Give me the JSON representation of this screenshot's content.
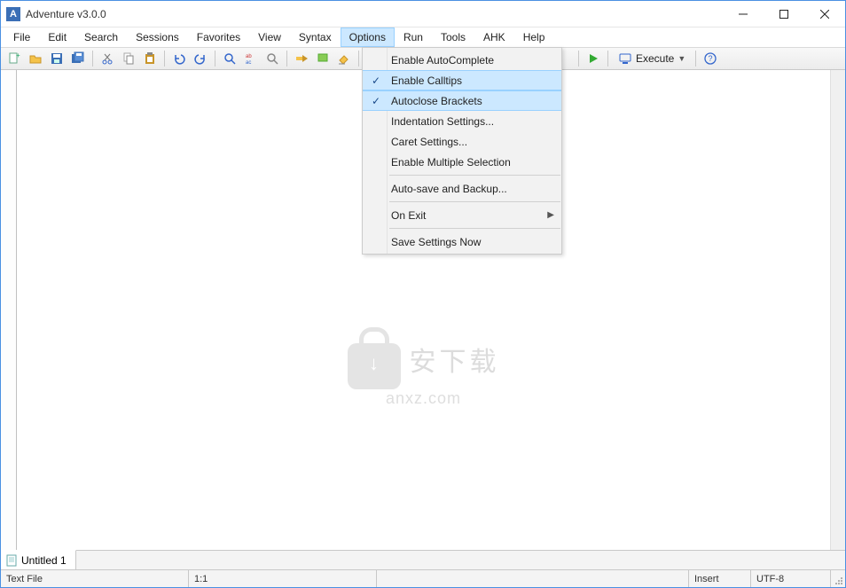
{
  "window": {
    "title": "Adventure v3.0.0"
  },
  "menubar": {
    "items": [
      "File",
      "Edit",
      "Search",
      "Sessions",
      "Favorites",
      "View",
      "Syntax",
      "Options",
      "Run",
      "Tools",
      "AHK",
      "Help"
    ],
    "active_index": 7
  },
  "toolbar": {
    "execute_label": "Execute"
  },
  "dropdown": {
    "items": [
      {
        "label": "Enable AutoComplete",
        "checked": false
      },
      {
        "label": "Enable Calltips",
        "checked": true
      },
      {
        "label": "Autoclose Brackets",
        "checked": true
      },
      {
        "label": "Indentation Settings...",
        "checked": false
      },
      {
        "label": "Caret Settings...",
        "checked": false
      },
      {
        "label": "Enable Multiple Selection",
        "checked": false
      },
      {
        "sep": true
      },
      {
        "label": "Auto-save and Backup...",
        "checked": false
      },
      {
        "sep": true
      },
      {
        "label": "On Exit",
        "checked": false,
        "submenu": true
      },
      {
        "sep": true
      },
      {
        "label": "Save Settings Now",
        "checked": false
      }
    ]
  },
  "tabs": {
    "items": [
      {
        "label": "Untitled 1"
      }
    ]
  },
  "statusbar": {
    "filetype": "Text File",
    "position": "1:1",
    "insert_mode": "Insert",
    "encoding": "UTF-8"
  },
  "watermark": {
    "cn": "安下载",
    "en": "anxz.com"
  }
}
